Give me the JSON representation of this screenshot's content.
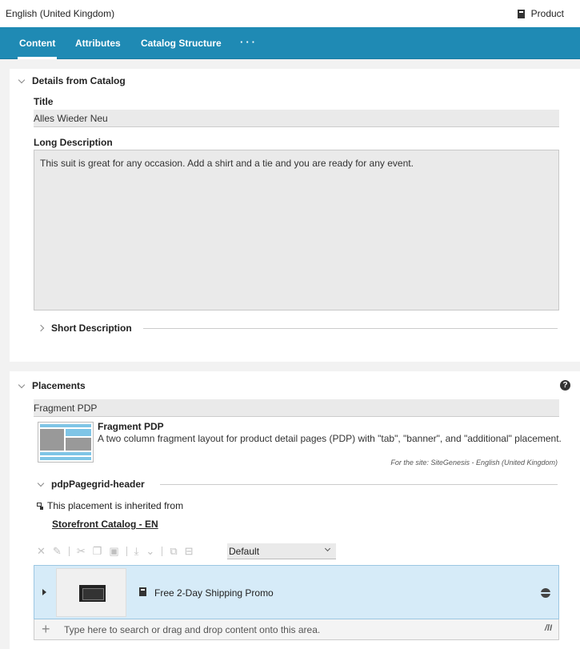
{
  "header": {
    "locale": "English (United Kingdom)",
    "object_type": "Product",
    "object_type_icon": "product-icon"
  },
  "tabs": [
    {
      "label": "Content",
      "active": true
    },
    {
      "label": "Attributes",
      "active": false
    },
    {
      "label": "Catalog Structure",
      "active": false
    },
    {
      "label": "···",
      "active": false
    }
  ],
  "details": {
    "section_title": "Details from Catalog",
    "title_label": "Title",
    "title_value": "Alles Wieder Neu",
    "long_desc_label": "Long Description",
    "long_desc_value": "This suit is great for any occasion. Add a shirt and a tie and you are ready for any event.",
    "short_desc_label": "Short Description"
  },
  "placements": {
    "section_title": "Placements",
    "help_icon": "?",
    "layout_value": "Fragment PDP",
    "layout_title": "Fragment PDP",
    "layout_description": "A two column fragment layout for product detail pages (PDP) with \"tab\", \"banner\", and \"additional\" placement.",
    "layout_site": "For the site: SiteGenesis - English (United Kingdom)",
    "placement_name": "pdpPagegrid-header",
    "inherited_text": "This placement is inherited from",
    "inherited_link": "Storefront Catalog - EN",
    "view_select": "Default",
    "item_name": "Free 2-Day Shipping Promo",
    "search_placeholder": "Type here to search or drag and drop content onto this area.",
    "search_aux": "/lI"
  },
  "colors": {
    "tab_bar": "#1f8ab4",
    "selected_row": "#d6ebf8"
  }
}
